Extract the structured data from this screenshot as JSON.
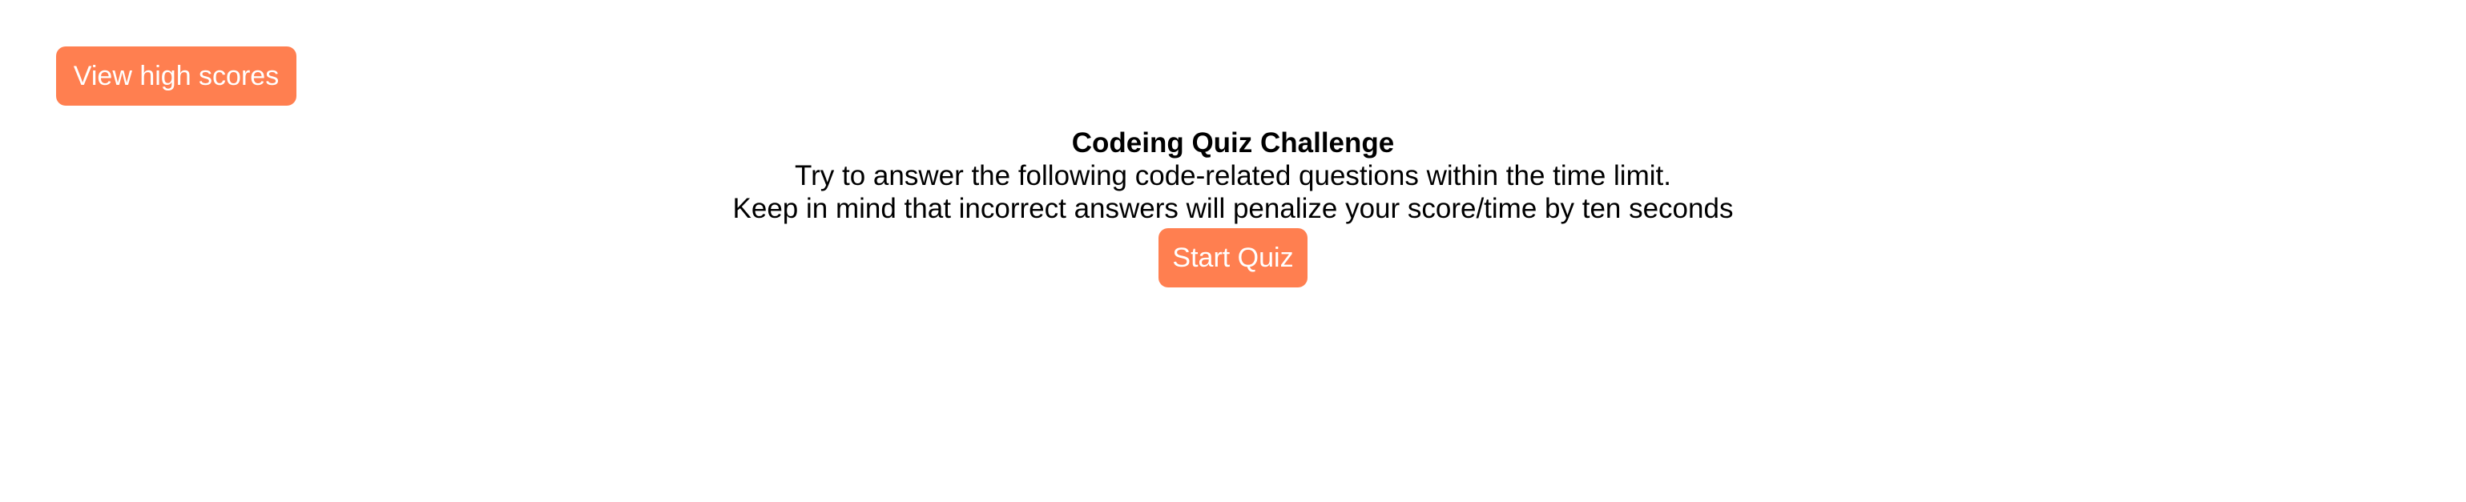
{
  "colors": {
    "button_background": "#ff7f50",
    "button_text": "#ffffff",
    "page_background": "#ffffff",
    "text": "#000000"
  },
  "header": {
    "view_high_scores_label": "View high scores"
  },
  "intro": {
    "title": "Codeing Quiz Challenge",
    "line1": "Try to answer the following code-related questions within the time limit.",
    "line2": "Keep in mind that incorrect answers will penalize your score/time by ten seconds",
    "start_label": "Start Quiz"
  }
}
